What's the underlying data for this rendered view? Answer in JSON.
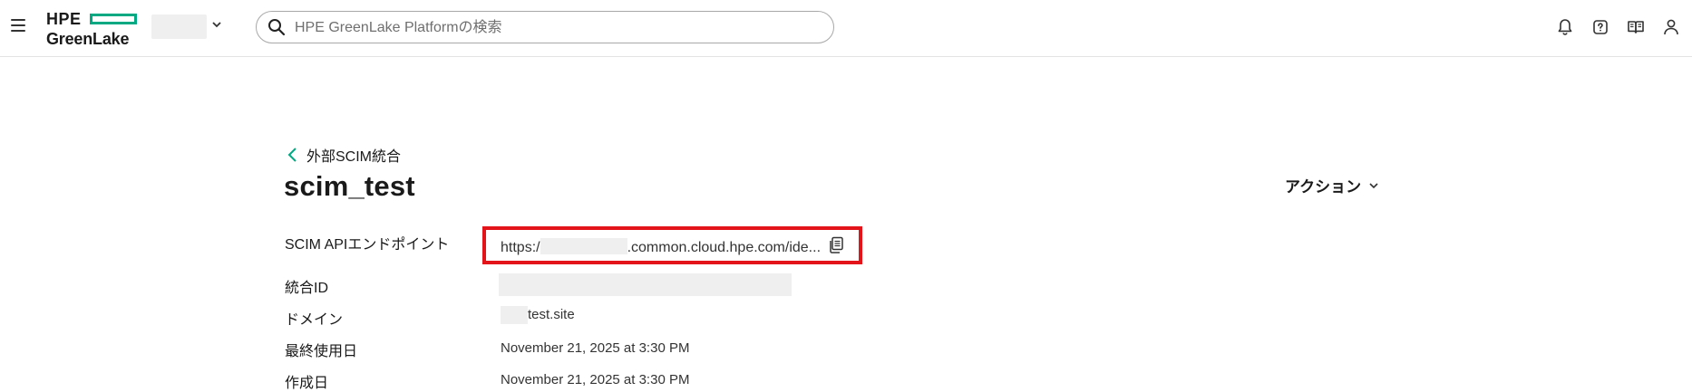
{
  "header": {
    "logo_top": "HPE",
    "logo_bottom": "GreenLake",
    "search_placeholder": "HPE GreenLake Platformの検索"
  },
  "nav": {
    "back_label": "外部SCIM統合"
  },
  "page": {
    "title": "scim_test",
    "actions_label": "アクション"
  },
  "details": {
    "endpoint_label": "SCIM APIエンドポイント",
    "endpoint_prefix": "https:/",
    "endpoint_suffix": ".common.cloud.hpe.com/ide...",
    "integration_id_label": "統合ID",
    "domain_label": "ドメイン",
    "domain_value": "test.site",
    "last_used_label": "最終使用日",
    "last_used_value": "November 21, 2025 at 3:30 PM",
    "created_label": "作成日",
    "created_value": "November 21, 2025 at 3:30 PM"
  },
  "colors": {
    "brand": "#01a982",
    "highlight": "#e4141b"
  }
}
